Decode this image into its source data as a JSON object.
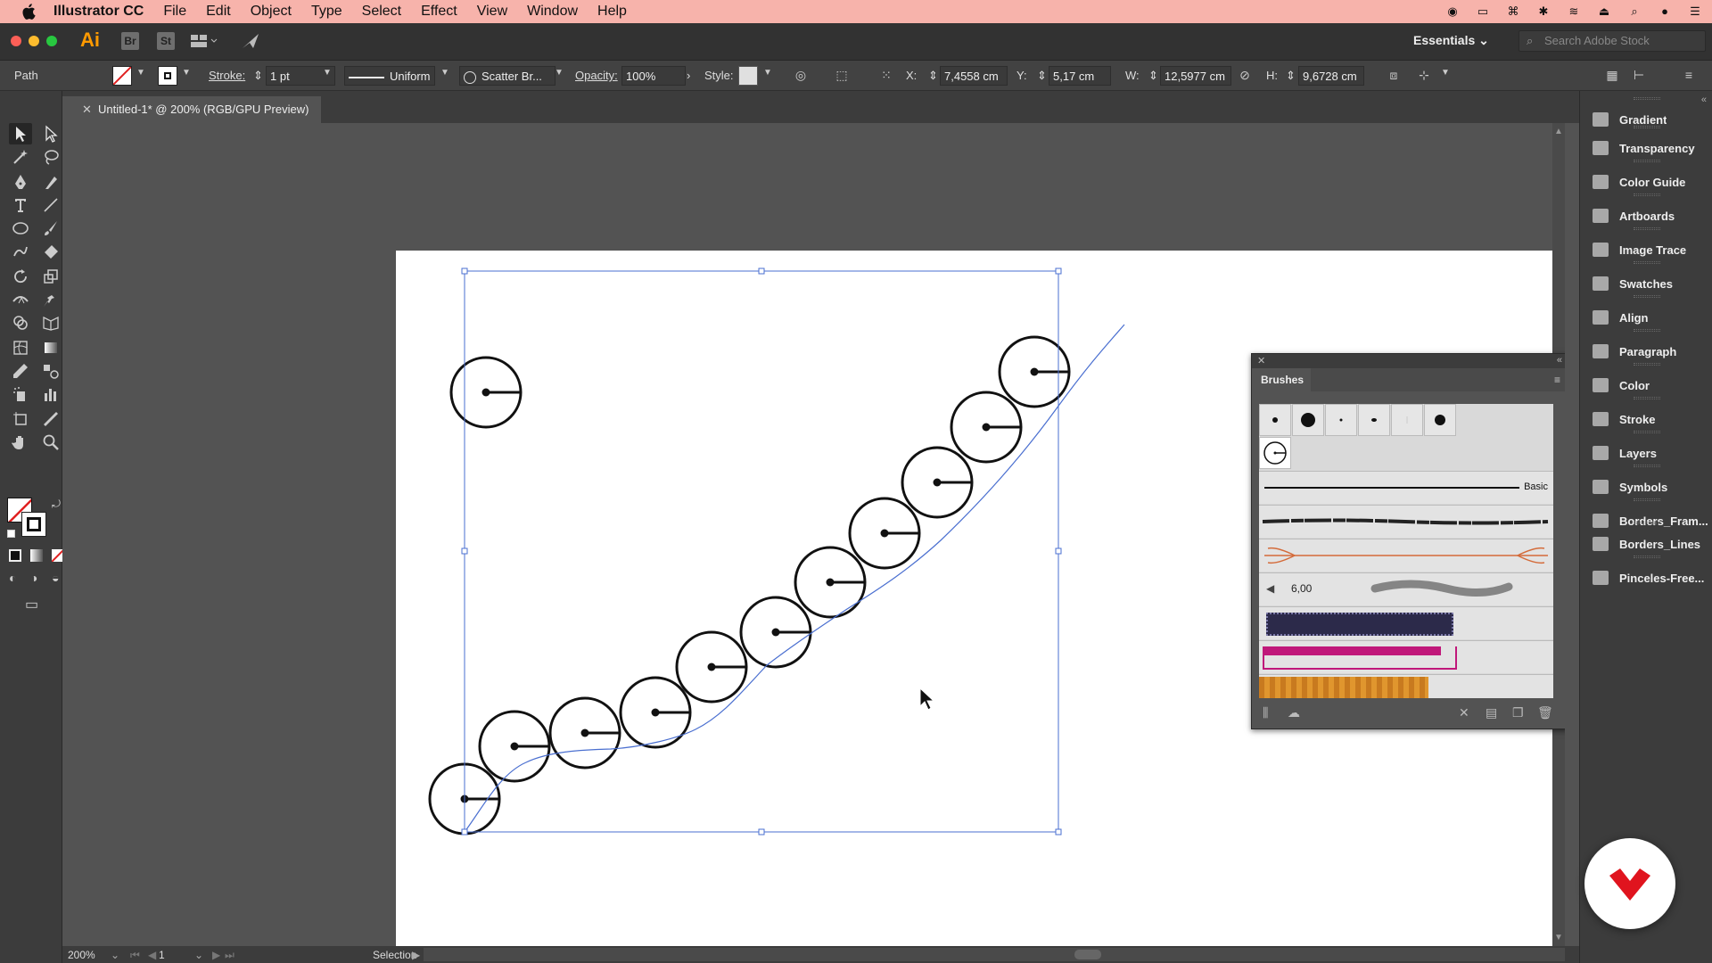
{
  "menubar": {
    "app": "Illustrator CC",
    "items": [
      "File",
      "Edit",
      "Object",
      "Type",
      "Select",
      "Effect",
      "View",
      "Window",
      "Help"
    ]
  },
  "appbar": {
    "logo": "Ai",
    "bridge": "Br",
    "stock": "St",
    "workspace": "Essentials",
    "search_placeholder": "Search Adobe Stock"
  },
  "control": {
    "selection_type": "Path",
    "stroke_label": "Stroke:",
    "stroke_weight": "1 pt",
    "profile": "Uniform",
    "brush": "Scatter Br...",
    "opacity_label": "Opacity:",
    "opacity": "100%",
    "style_label": "Style:",
    "x_label": "X:",
    "x": "7,4558 cm",
    "y_label": "Y:",
    "y": "5,17 cm",
    "w_label": "W:",
    "w": "12,5977 cm",
    "h_label": "H:",
    "h": "9,6728 cm"
  },
  "document": {
    "tab": "Untitled-1* @ 200% (RGB/GPU Preview)"
  },
  "brushes": {
    "title": "Brushes",
    "basic_label": "Basic",
    "size_value": "6,00"
  },
  "dock": {
    "items": [
      {
        "label": "Gradient",
        "icon": "gradient-icon"
      },
      {
        "label": "Transparency",
        "icon": "transparency-icon"
      },
      {
        "label": "Color Guide",
        "icon": "color-guide-icon"
      },
      {
        "label": "Artboards",
        "icon": "artboards-icon"
      },
      {
        "label": "Image Trace",
        "icon": "image-trace-icon"
      },
      {
        "label": "Swatches",
        "icon": "swatches-icon"
      },
      {
        "label": "Align",
        "icon": "align-icon"
      },
      {
        "label": "Paragraph",
        "icon": "paragraph-icon"
      },
      {
        "label": "Color",
        "icon": "color-icon"
      },
      {
        "label": "Stroke",
        "icon": "stroke-icon"
      },
      {
        "label": "Layers",
        "icon": "layers-icon"
      },
      {
        "label": "Symbols",
        "icon": "symbols-icon"
      },
      {
        "label": "Borders_Fram...",
        "icon": "library-icon"
      },
      {
        "label": "Borders_Lines",
        "icon": "library-icon"
      },
      {
        "label": "Pinceles-Free...",
        "icon": "library-icon"
      }
    ]
  },
  "status": {
    "zoom": "200%",
    "artboard_number": "1",
    "tool": "Selection"
  },
  "colors": {
    "menubar_bg": "#f7b3ab",
    "accent_ai": "#ff9a00",
    "selection_blue": "#4a6fd0"
  }
}
